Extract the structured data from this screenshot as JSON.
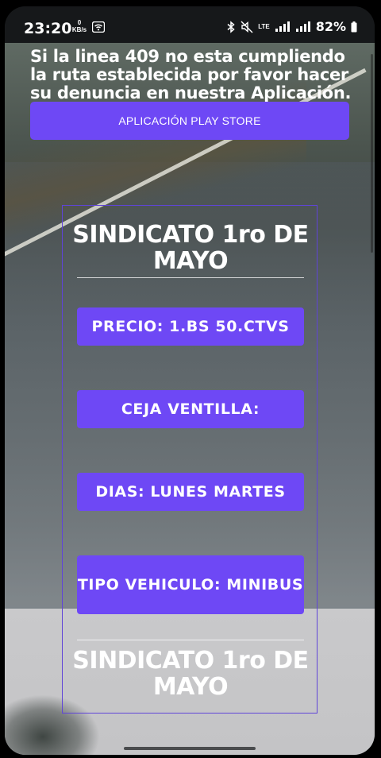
{
  "status_bar": {
    "time": "23:20",
    "net_speed_value": "0",
    "net_speed_unit": "KB/s",
    "network_type": "LTE",
    "battery": "82%"
  },
  "notice": {
    "text": "Si la linea 409 no esta cumpliendo la ruta establecida por favor hacer su denuncia en nuestra Aplicación."
  },
  "store_button": {
    "label": "APLICACIÓN PLAY STORE"
  },
  "panel": {
    "title_top": "SINDICATO 1ro DE MAYO",
    "title_bottom": "SINDICATO 1ro DE MAYO",
    "items": [
      {
        "label": "PRECIO: 1.BS 50.CTVS"
      },
      {
        "label": "CEJA VENTILLA:"
      },
      {
        "label": "DIAS: LUNES MARTES"
      },
      {
        "label": "TIPO VEHICULO: MINIBUS"
      }
    ]
  },
  "colors": {
    "accent": "#6e48f5",
    "panel_border": "#5f44d8",
    "text": "#ffffff"
  }
}
